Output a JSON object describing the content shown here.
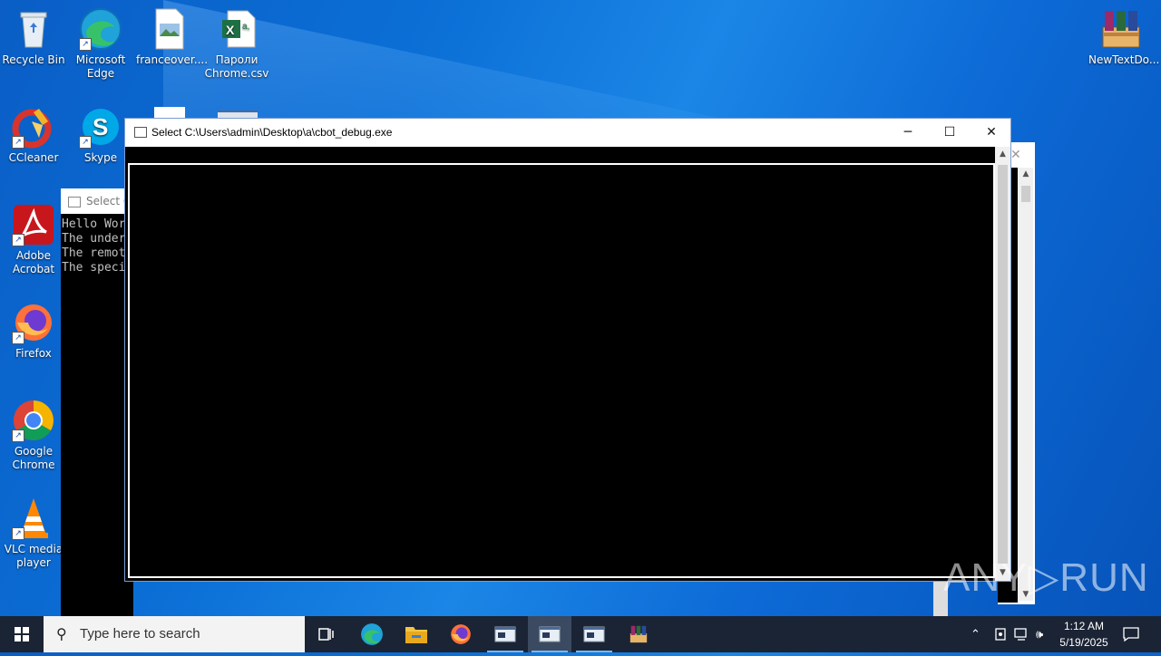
{
  "desktop": {
    "icons": [
      {
        "label": "Recycle Bin"
      },
      {
        "label": "Microsoft Edge"
      },
      {
        "label": "franceover...."
      },
      {
        "label": "Пароли Chrome.csv"
      },
      {
        "label": "CCleaner"
      },
      {
        "label": "Skype"
      },
      {
        "label": "Adobe Acrobat"
      },
      {
        "label": "Firefox"
      },
      {
        "label": "Google Chrome"
      },
      {
        "label": "VLC media player"
      },
      {
        "label": "NewTextDo..."
      }
    ]
  },
  "back_window": {
    "title": "Select C",
    "lines": "Hello Wor\nThe under\nThe remot\nThe speci"
  },
  "main_window": {
    "title": "Select C:\\Users\\admin\\Desktop\\a\\cbot_debug.exe",
    "minimize": "─",
    "maximize": "☐",
    "close": "✕"
  },
  "watermark": "ANY▷RUN",
  "taskbar": {
    "search_placeholder": "Type here to search",
    "time": "1:12 AM",
    "date": "5/19/2025"
  },
  "colors": {
    "taskbar": "#1b2434",
    "desktop": "#0b6fd6",
    "accent": "#76b9ed"
  }
}
